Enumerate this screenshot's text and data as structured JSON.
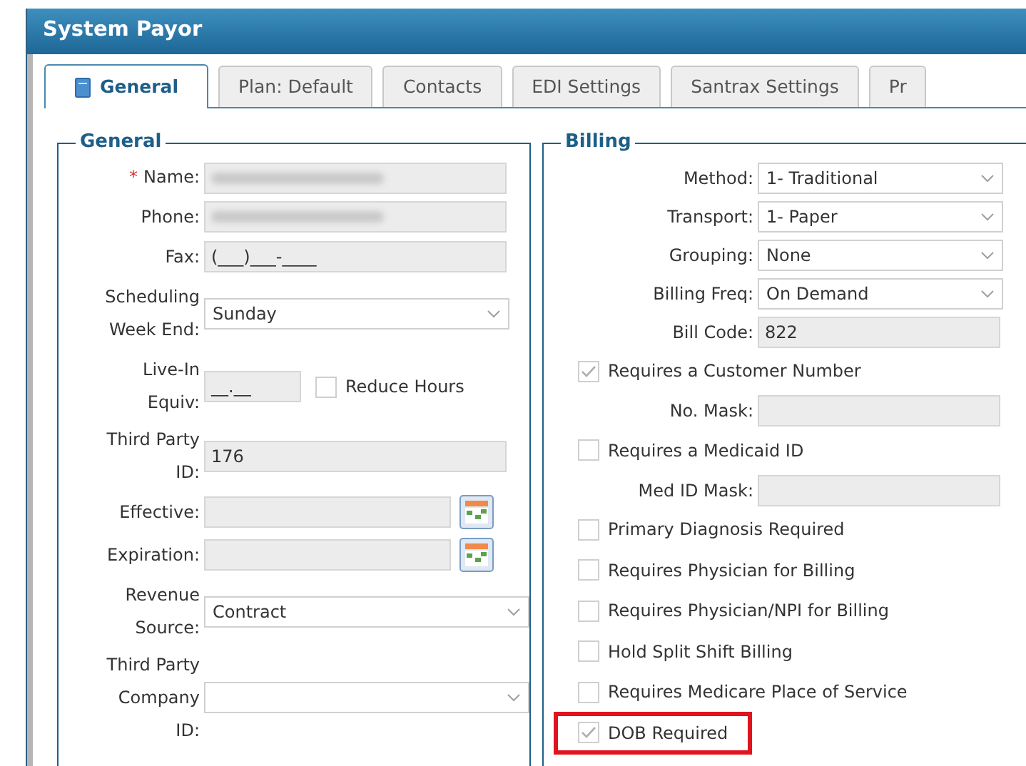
{
  "window": {
    "title": "System Payor"
  },
  "tabs": [
    {
      "label": "General",
      "selected": true,
      "icon": true
    },
    {
      "label": "Plan: Default",
      "selected": false
    },
    {
      "label": "Contacts",
      "selected": false
    },
    {
      "label": "EDI Settings",
      "selected": false
    },
    {
      "label": "Santrax Settings",
      "selected": false
    },
    {
      "label": "Pr",
      "selected": false
    }
  ],
  "general": {
    "legend": "General",
    "fields": [
      {
        "kind": "text",
        "label": [
          "Name:"
        ],
        "required_mark": "*",
        "redacted": true
      },
      {
        "kind": "text",
        "label": [
          "Phone:"
        ],
        "redacted": true
      },
      {
        "kind": "text",
        "label": [
          "Fax:"
        ],
        "value": "(___)___-____"
      },
      {
        "kind": "select",
        "label": [
          "Scheduling",
          "Week End:"
        ],
        "value": "Sunday"
      },
      {
        "kind": "equiv",
        "label": [
          "Live-In",
          "Equiv:"
        ],
        "value": "__.__",
        "checkbox": {
          "label": "Reduce Hours",
          "checked": false
        }
      },
      {
        "kind": "text",
        "label": [
          "Third Party",
          "ID:"
        ],
        "value": "176"
      },
      {
        "kind": "date",
        "label": [
          "Effective:"
        ]
      },
      {
        "kind": "date",
        "label": [
          "Expiration:"
        ]
      },
      {
        "kind": "select",
        "label": [
          "Revenue",
          "Source:"
        ],
        "value": "Contract"
      },
      {
        "kind": "select",
        "label": [
          "Third Party",
          "Company",
          "ID:"
        ]
      }
    ]
  },
  "billing": {
    "legend": "Billing",
    "fields": [
      {
        "kind": "select",
        "label": "Method:",
        "value": "1- Traditional"
      },
      {
        "kind": "select",
        "label": "Transport:",
        "value": "1- Paper"
      },
      {
        "kind": "select",
        "label": "Grouping:",
        "value": "None"
      },
      {
        "kind": "select",
        "label": "Billing Freq:",
        "value": "On Demand"
      },
      {
        "kind": "text",
        "label": "Bill Code:",
        "value": "822"
      },
      {
        "kind": "checkbox",
        "label": "Requires a Customer Number",
        "checked": true,
        "highlighted": false
      },
      {
        "kind": "text",
        "label": "No. Mask:"
      },
      {
        "kind": "checkbox",
        "label": "Requires a Medicaid ID",
        "checked": false,
        "highlighted": false
      },
      {
        "kind": "text",
        "label": "Med ID Mask:"
      },
      {
        "kind": "checkbox",
        "label": "Primary Diagnosis Required",
        "checked": false,
        "highlighted": false
      },
      {
        "kind": "checkbox",
        "label": "Requires Physician for Billing",
        "checked": false,
        "highlighted": false
      },
      {
        "kind": "checkbox",
        "label": "Requires Physician/NPI for Billing",
        "checked": false,
        "highlighted": false
      },
      {
        "kind": "checkbox",
        "label": "Hold Split Shift Billing",
        "checked": false,
        "highlighted": false
      },
      {
        "kind": "checkbox",
        "label": "Requires Medicare Place of Service",
        "checked": false,
        "highlighted": false
      },
      {
        "kind": "checkbox",
        "label": "DOB Required",
        "checked": true,
        "highlighted": true
      }
    ]
  }
}
